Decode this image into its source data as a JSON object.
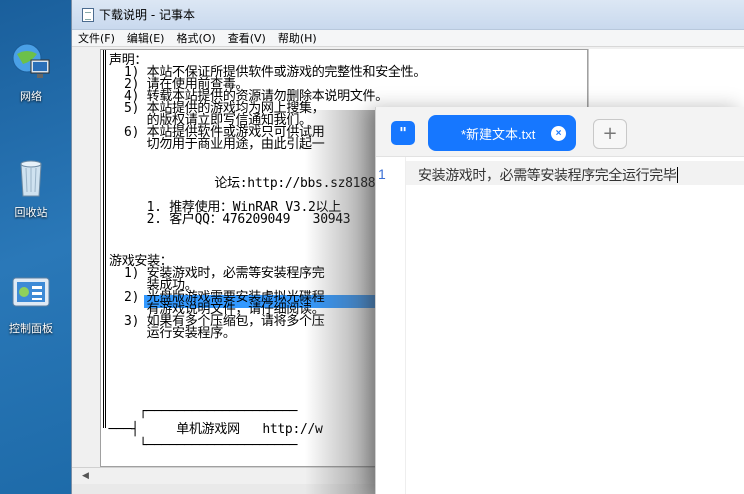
{
  "desktop": {
    "icons": [
      {
        "label": "网络"
      },
      {
        "label": "回收站"
      },
      {
        "label": "控制面板"
      }
    ]
  },
  "notepad": {
    "title": "下载说明 - 记事本",
    "menu": [
      "文件(F)",
      "编辑(E)",
      "格式(O)",
      "查看(V)",
      "帮助(H)"
    ],
    "lines": [
      "声明：",
      "  1) 本站不保证所提供软件或游戏的完整性和安全性。",
      "  2) 请在使用前查毒。",
      "  4) 转载本站提供的资源请勿删除本说明文件。",
      "  5) 本站提供的游戏均为网上搜集，",
      "     的版权请立即写信通知我们。",
      "  6) 本站提供软件或游戏只可供试用",
      "     切勿用于商业用途，由此引起一",
      "",
      "              论坛:http://bbs.sz8188",
      "",
      "     1. 推荐使用：WinRAR V3.2以上",
      "     2. 客户QQ：476209049   30943",
      "",
      "游戏安装：",
      "  1) 安装游戏时，必需等安装程序完",
      "     装成功。",
      "  2) 光盘版游戏需要安装虚拟光碟程",
      "     有游戏说明文件，请仔细阅读。",
      "  3) 如果有多个压缩包，请将多个压",
      "     运行安装程序。",
      "",
      "    ┌────────────────────",
      " ───┤     单机游戏网   http://w",
      "    └────────────────────"
    ]
  },
  "editor": {
    "logo": "\"",
    "tab_label": "*新建文本.txt",
    "tab_close": "×",
    "tab_add": "+",
    "line_number": "1",
    "line_text": "安装游戏时，必需等安装程序完全运行完毕"
  },
  "colors": {
    "accent": "#1677ff",
    "selection": "#3399ff",
    "desktop": "#1d6aa8"
  }
}
